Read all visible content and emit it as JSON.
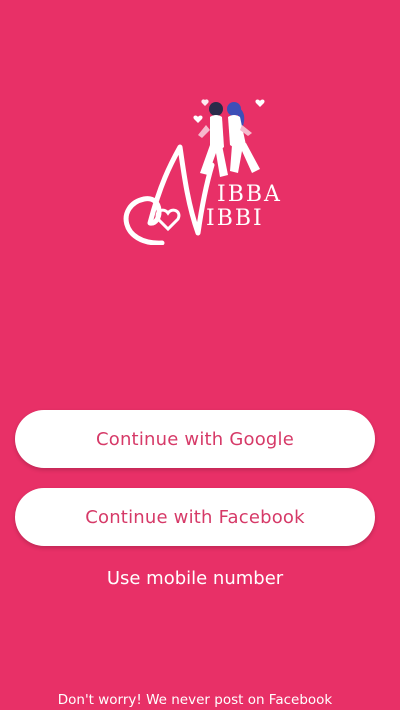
{
  "brand": {
    "logo_text_line1": "IBBA",
    "logo_text_line2": "IBBI",
    "logo_name": "Nibba Nibbi"
  },
  "actions": {
    "google_label": "Continue with Google",
    "facebook_label": "Continue with Facebook",
    "mobile_label": "Use mobile number"
  },
  "footer": {
    "note": "Don't worry! We never post on Facebook"
  },
  "colors": {
    "background": "#e83067",
    "button_bg": "#ffffff",
    "button_text": "#d63a68",
    "text_light": "#ffffff"
  }
}
